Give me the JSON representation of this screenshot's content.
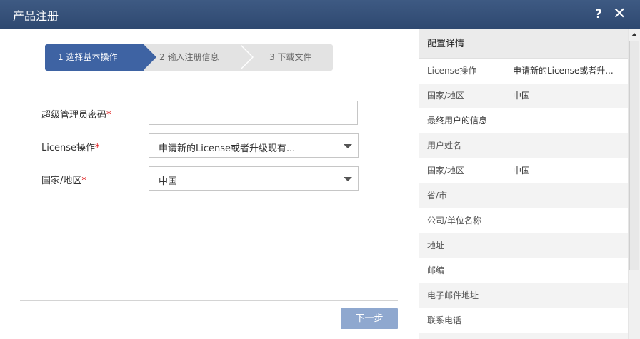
{
  "window": {
    "title": "产品注册",
    "help_icon": "?",
    "close_icon": "✕"
  },
  "wizard": {
    "steps": [
      {
        "label": "1 选择基本操作"
      },
      {
        "label": "2 输入注册信息"
      },
      {
        "label": "3 下载文件"
      }
    ],
    "active_color": "#3e63a3"
  },
  "form": {
    "password": {
      "label": "超级管理员密码",
      "required_mark": "*",
      "value": ""
    },
    "license_op": {
      "label": "License操作",
      "required_mark": "*",
      "value": "申请新的License或者升级现有..."
    },
    "country": {
      "label": "国家/地区",
      "required_mark": "*",
      "value": "中国"
    },
    "next_label": "下一步"
  },
  "panel": {
    "title": "配置详情",
    "rows": [
      {
        "key": "License操作",
        "value": "申请新的License或者升..."
      },
      {
        "key": "国家/地区",
        "value": "中国"
      },
      {
        "key": "最终用户的信息",
        "value": ""
      },
      {
        "key": "用户姓名",
        "value": ""
      },
      {
        "key": "国家/地区",
        "value": "中国"
      },
      {
        "key": "省/市",
        "value": ""
      },
      {
        "key": "公司/单位名称",
        "value": ""
      },
      {
        "key": "地址",
        "value": ""
      },
      {
        "key": "邮编",
        "value": ""
      },
      {
        "key": "电子邮件地址",
        "value": ""
      },
      {
        "key": "联系电话",
        "value": ""
      }
    ]
  },
  "colors": {
    "titlebar": "#34507a",
    "button": "#8fa8cf",
    "required": "#dd0000"
  }
}
